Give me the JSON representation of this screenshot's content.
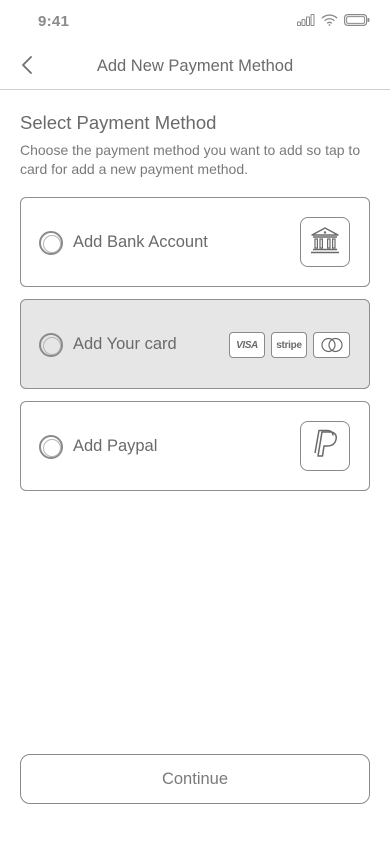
{
  "status_bar": {
    "time": "9:41"
  },
  "header": {
    "title": "Add New Payment Method"
  },
  "section": {
    "title": "Select Payment Method",
    "description": "Choose the payment method you want to add so tap to card for add a new payment method."
  },
  "options": [
    {
      "label": "Add Bank Account",
      "icon": "bank-icon",
      "selected": false
    },
    {
      "label": "Add Your card",
      "brands": [
        "VISA",
        "stripe",
        "mastercard"
      ],
      "selected": true
    },
    {
      "label": "Add Paypal",
      "icon": "paypal-icon",
      "selected": false
    }
  ],
  "brand_labels": {
    "visa": "VISA",
    "stripe": "stripe"
  },
  "continue_label": "Continue",
  "colors": {
    "border": "#8f8f8f",
    "selected_bg": "#e6e6e6",
    "text": "#6a6a6a"
  }
}
